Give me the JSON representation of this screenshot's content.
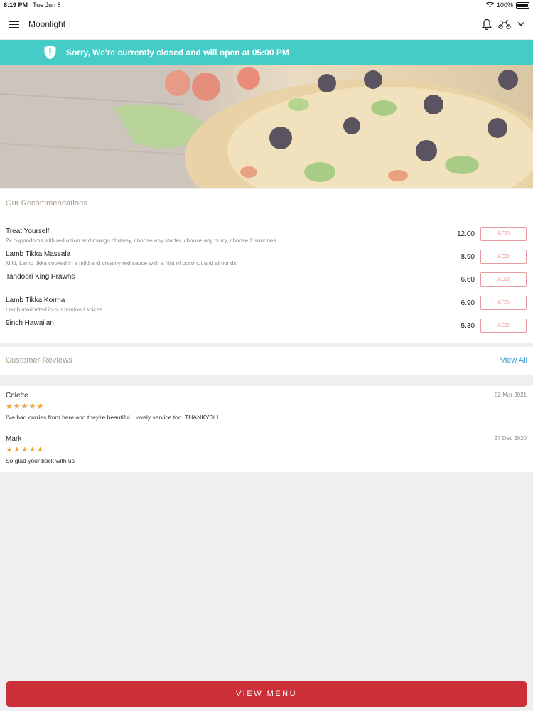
{
  "status_bar": {
    "time": "6:19 PM",
    "date": "Tue Jun 8",
    "battery": "100%"
  },
  "header": {
    "title": "Moonlight",
    "icons": [
      "menu-icon",
      "bell-icon",
      "delivery-bike-icon",
      "chevron-down-icon"
    ]
  },
  "banner": {
    "message": "Sorry, We're currently closed and will open at 05:00 PM",
    "color": "#45ccc7"
  },
  "recommendations": {
    "title": "Our Recommendations",
    "items": [
      {
        "name": "Treat Yourself",
        "description": "2x poppadoms with red onion and mango chutney, choose any starter, choose any curry, choose 2 sundries",
        "price": "12.00",
        "button": "ADD"
      },
      {
        "name": "Lamb Tikka Massala",
        "description": "Mild, Lamb tikka cooked in a mild and creamy red sauce with a hint of coconut and almonds",
        "price": "8.90",
        "button": "ADD"
      },
      {
        "name": "Tandoori King Prawns",
        "description": "",
        "price": "6.60",
        "button": "ADD"
      },
      {
        "name": "Lamb Tikka Korma",
        "description": "Lamb marinated in our tandoori spices",
        "price": "6.90",
        "button": "ADD"
      },
      {
        "name": "9inch Hawaiian",
        "description": "",
        "price": "5.30",
        "button": "ADD"
      }
    ]
  },
  "reviews": {
    "title": "Customer Reviews",
    "view_all": "View All",
    "items": [
      {
        "author": "Colette",
        "date": "02 Mar 2021",
        "stars": "★★★★★",
        "rating": 5,
        "text": "I've had curries from here and they're beautiful. Lovely service too.  THANKYOU"
      },
      {
        "author": "Mark",
        "date": "27 Dec 2020",
        "stars": "★★★★★",
        "rating": 5,
        "text": "So glad your back with us"
      }
    ]
  },
  "footer": {
    "button": "VIEW MENU",
    "color": "#cb2f38"
  }
}
